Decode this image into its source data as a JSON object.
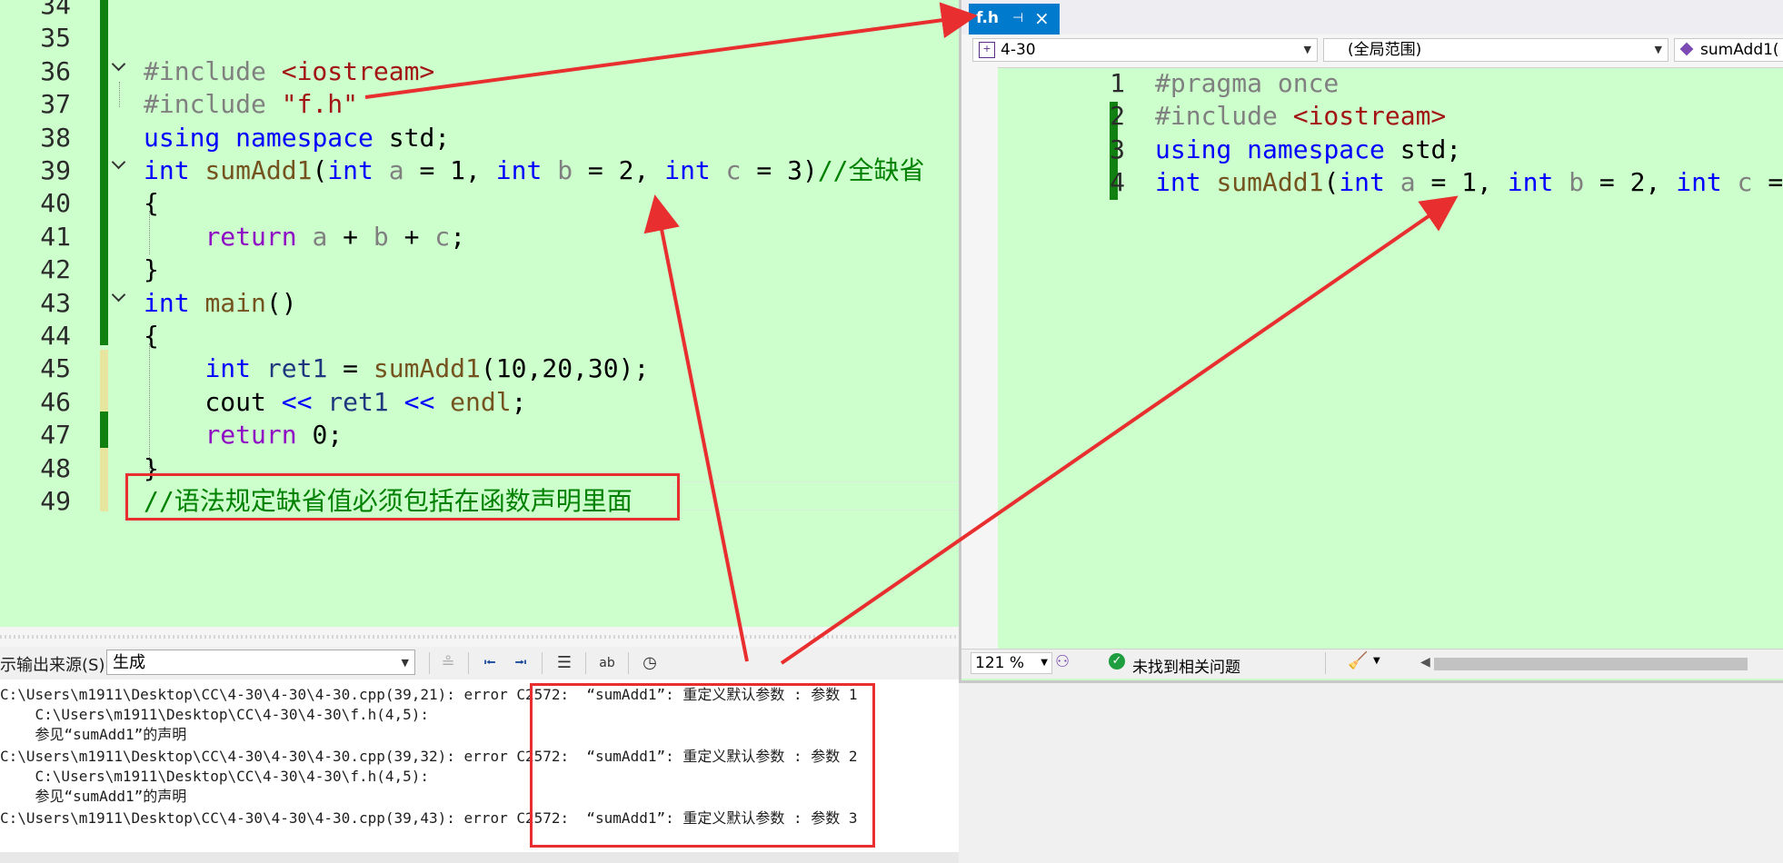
{
  "main_editor": {
    "lines": [
      {
        "num": "34",
        "tokens": []
      },
      {
        "num": "35",
        "tokens": []
      },
      {
        "num": "36",
        "tokens": [
          {
            "t": "#include ",
            "c": "pp"
          },
          {
            "t": "<iostream>",
            "c": "str"
          }
        ]
      },
      {
        "num": "37",
        "tokens": [
          {
            "t": "#include ",
            "c": "pp"
          },
          {
            "t": "\"f.h\"",
            "c": "str"
          }
        ]
      },
      {
        "num": "38",
        "tokens": [
          {
            "t": "using ",
            "c": "kw"
          },
          {
            "t": "namespace ",
            "c": "kw"
          },
          {
            "t": "std;",
            "c": ""
          }
        ]
      },
      {
        "num": "39",
        "tokens": [
          {
            "t": "int ",
            "c": "kw"
          },
          {
            "t": "sumAdd1",
            "c": "fn"
          },
          {
            "t": "(",
            "c": ""
          },
          {
            "t": "int ",
            "c": "kw"
          },
          {
            "t": "a",
            "c": "par"
          },
          {
            "t": " = 1, ",
            "c": ""
          },
          {
            "t": "int ",
            "c": "kw"
          },
          {
            "t": "b",
            "c": "par"
          },
          {
            "t": " = 2, ",
            "c": ""
          },
          {
            "t": "int ",
            "c": "kw"
          },
          {
            "t": "c",
            "c": "par"
          },
          {
            "t": " = 3)",
            "c": ""
          },
          {
            "t": "//全缺省",
            "c": "cm"
          }
        ]
      },
      {
        "num": "40",
        "tokens": [
          {
            "t": "{",
            "c": ""
          }
        ]
      },
      {
        "num": "41",
        "tokens": [
          {
            "t": "    ",
            "c": ""
          },
          {
            "t": "return ",
            "c": "ctrl"
          },
          {
            "t": "a",
            "c": "par"
          },
          {
            "t": " + ",
            "c": ""
          },
          {
            "t": "b",
            "c": "par"
          },
          {
            "t": " + ",
            "c": ""
          },
          {
            "t": "c",
            "c": "par"
          },
          {
            "t": ";",
            "c": ""
          }
        ]
      },
      {
        "num": "42",
        "tokens": [
          {
            "t": "}",
            "c": ""
          }
        ]
      },
      {
        "num": "43",
        "tokens": [
          {
            "t": "int ",
            "c": "kw"
          },
          {
            "t": "main",
            "c": "fn"
          },
          {
            "t": "()",
            "c": ""
          }
        ]
      },
      {
        "num": "44",
        "tokens": [
          {
            "t": "{",
            "c": ""
          }
        ]
      },
      {
        "num": "45",
        "tokens": [
          {
            "t": "    ",
            "c": ""
          },
          {
            "t": "int ",
            "c": "kw"
          },
          {
            "t": "ret1",
            "c": "loc"
          },
          {
            "t": " = ",
            "c": ""
          },
          {
            "t": "sumAdd1",
            "c": "fn"
          },
          {
            "t": "(10,20,30);",
            "c": ""
          }
        ]
      },
      {
        "num": "46",
        "tokens": [
          {
            "t": "    cout ",
            "c": ""
          },
          {
            "t": "<< ",
            "c": "kw"
          },
          {
            "t": "ret1",
            "c": "loc"
          },
          {
            "t": " ",
            "c": ""
          },
          {
            "t": "<< ",
            "c": "kw"
          },
          {
            "t": "endl",
            "c": "fn"
          },
          {
            "t": ";",
            "c": ""
          }
        ]
      },
      {
        "num": "47",
        "tokens": [
          {
            "t": "    ",
            "c": ""
          },
          {
            "t": "return ",
            "c": "ctrl"
          },
          {
            "t": "0;",
            "c": ""
          }
        ]
      },
      {
        "num": "48",
        "tokens": [
          {
            "t": "}",
            "c": ""
          }
        ]
      },
      {
        "num": "49",
        "tokens": [
          {
            "t": "//语法规定缺省值必须包括在函数声明里面",
            "c": "cm"
          }
        ]
      }
    ]
  },
  "output_panel": {
    "source_label": "示输出来源(S):",
    "source_value": "生成",
    "lines": [
      "C:\\Users\\m1911\\Desktop\\CC\\4-30\\4-30\\4-30.cpp(39,21): error C2572:  “sumAdd1”: 重定义默认参数 : 参数 1",
      "    C:\\Users\\m1911\\Desktop\\CC\\4-30\\4-30\\f.h(4,5):",
      "    参见“sumAdd1”的声明",
      "C:\\Users\\m1911\\Desktop\\CC\\4-30\\4-30\\4-30.cpp(39,32): error C2572:  “sumAdd1”: 重定义默认参数 : 参数 2",
      "    C:\\Users\\m1911\\Desktop\\CC\\4-30\\4-30\\f.h(4,5):",
      "    参见“sumAdd1”的声明",
      "C:\\Users\\m1911\\Desktop\\CC\\4-30\\4-30\\4-30.cpp(39,43): error C2572:  “sumAdd1”: 重定义默认参数 : 参数 3"
    ]
  },
  "float_window": {
    "tab_name": "f.h",
    "project": "4-30",
    "scope": "(全局范围)",
    "member": "sumAdd1(",
    "lines": [
      {
        "num": "1",
        "tokens": [
          {
            "t": "#pragma ",
            "c": "pp"
          },
          {
            "t": "once",
            "c": "pp"
          }
        ]
      },
      {
        "num": "2",
        "tokens": [
          {
            "t": "#include ",
            "c": "pp"
          },
          {
            "t": "<iostream>",
            "c": "str"
          }
        ]
      },
      {
        "num": "3",
        "tokens": [
          {
            "t": "using ",
            "c": "kw"
          },
          {
            "t": "namespace ",
            "c": "kw"
          },
          {
            "t": "std;",
            "c": ""
          }
        ]
      },
      {
        "num": "4",
        "tokens": [
          {
            "t": "int ",
            "c": "kw"
          },
          {
            "t": "sumAdd1",
            "c": "fn"
          },
          {
            "t": "(",
            "c": ""
          },
          {
            "t": "int ",
            "c": "kw"
          },
          {
            "t": "a",
            "c": "par"
          },
          {
            "t": " = 1, ",
            "c": ""
          },
          {
            "t": "int ",
            "c": "kw"
          },
          {
            "t": "b",
            "c": "par"
          },
          {
            "t": " = 2, ",
            "c": ""
          },
          {
            "t": "int ",
            "c": "kw"
          },
          {
            "t": "c",
            "c": "par"
          },
          {
            "t": " =",
            "c": ""
          }
        ]
      }
    ],
    "zoom": "121 %",
    "status_message": "未找到相关问题"
  },
  "colors": {
    "editor_bg": "#ccffcc",
    "change_bar_saved": "#108010",
    "change_bar_unsaved": "#e6e6a0",
    "annotation_red": "#e82e2e",
    "tab_accent": "#007acc"
  }
}
